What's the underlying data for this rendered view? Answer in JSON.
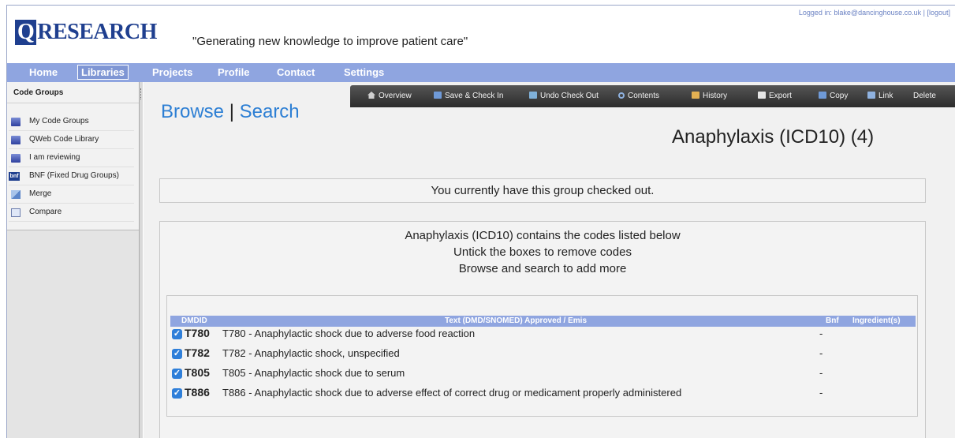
{
  "header": {
    "logo_q": "Q",
    "logo_rest": "RESEARCH",
    "tagline": "\"Generating new knowledge to improve patient care\"",
    "login_text": "Logged in: blake@dancinghouse.co.uk | [logout]"
  },
  "nav": {
    "items": [
      "Home",
      "Libraries",
      "Projects",
      "Profile",
      "Contact",
      "Settings"
    ],
    "active": "Libraries"
  },
  "sidebar": {
    "title": "Code Groups",
    "items": [
      {
        "label": "My Code Groups",
        "icon": "database-icon"
      },
      {
        "label": "QWeb Code Library",
        "icon": "database-icon"
      },
      {
        "label": "I am reviewing",
        "icon": "database-icon"
      },
      {
        "label": "BNF (Fixed Drug Groups)",
        "icon": "bnf-icon",
        "icon_text": "bnf"
      },
      {
        "label": "Merge",
        "icon": "merge-icon"
      },
      {
        "label": "Compare",
        "icon": "compare-icon"
      }
    ]
  },
  "toolbar": {
    "items": [
      "Overview",
      "Save & Check In",
      "Undo Check Out",
      "Contents",
      "History",
      "Export",
      "Copy",
      "Link",
      "Delete"
    ]
  },
  "main": {
    "browse_label": "Browse",
    "separator": "|",
    "search_label": "Search",
    "group_title": "Anaphylaxis (ICD10) (4)",
    "notice": "You currently have this group checked out.",
    "info_lines": [
      "Anaphylaxis (ICD10) contains the codes listed below",
      "Untick the boxes to remove codes",
      "Browse and search to add more"
    ]
  },
  "codes_table": {
    "headers": {
      "dmdid": "DMDID",
      "text": "Text (DMD/SNOMED) Approved / Emis",
      "bnf": "Bnf",
      "ingredients": "Ingredient(s)"
    },
    "rows": [
      {
        "code": "T780",
        "text": "T780 - Anaphylactic shock due to adverse food reaction",
        "bnf": "-",
        "checked": true
      },
      {
        "code": "T782",
        "text": "T782 - Anaphylactic shock, unspecified",
        "bnf": "-",
        "checked": true
      },
      {
        "code": "T805",
        "text": "T805 - Anaphylactic shock due to serum",
        "bnf": "-",
        "checked": true
      },
      {
        "code": "T886",
        "text": "T886 - Anaphylactic shock due to adverse effect of correct drug or medicament properly administered",
        "bnf": "-",
        "checked": true
      }
    ]
  },
  "colors": {
    "nav_bg": "#8fa5e0",
    "brand_blue": "#1f3f8f",
    "link_blue": "#2d7fd4",
    "checkbox_blue": "#2f7fd9"
  }
}
